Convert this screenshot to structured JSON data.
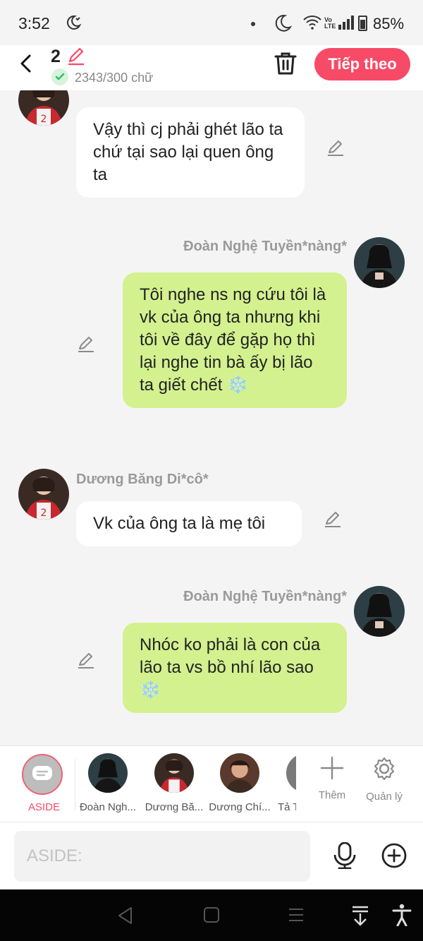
{
  "status_bar": {
    "time": "3:52",
    "battery": "85%",
    "volte_top": "Vo",
    "volte_bottom": "LTE"
  },
  "header": {
    "count": "2",
    "word_count": "2343/300 chữ",
    "next_label": "Tiếp theo"
  },
  "messages": [
    {
      "side": "left",
      "sender": "Dương Băng Di*cô*",
      "text": "Vậy thì cj phải ghét lão ta chứ tại sao lại quen ông ta"
    },
    {
      "side": "right",
      "sender": "Đoàn Nghệ Tuyền*nàng*",
      "text": "Tôi nghe ns ng cứu tôi là vk của ông ta nhưng khi tôi về đây để gặp họ thì lại nghe tin bà ấy bị lão ta giết chết ❄️"
    },
    {
      "side": "left",
      "sender": "Dương Băng Di*cô*",
      "text": "Vk của ông ta là mẹ tôi"
    },
    {
      "side": "right",
      "sender": "Đoàn Nghệ Tuyền*nàng*",
      "text": "Nhóc ko phải là con của lão ta vs bồ nhí lão sao ❄️"
    }
  ],
  "character_bar": {
    "aside_label": "ASIDE",
    "characters": [
      {
        "name": "Đoàn Ngh..."
      },
      {
        "name": "Dương Bă..."
      },
      {
        "name": "Dương Chí..."
      },
      {
        "name": "Tả T"
      }
    ],
    "add_label": "Thêm",
    "manage_label": "Quản lý"
  },
  "input": {
    "placeholder": "ASIDE:"
  },
  "colors": {
    "accent": "#f74a67",
    "my_bubble": "#d3f18f",
    "other_bubble": "#ffffff",
    "background": "#f4f4f4"
  }
}
